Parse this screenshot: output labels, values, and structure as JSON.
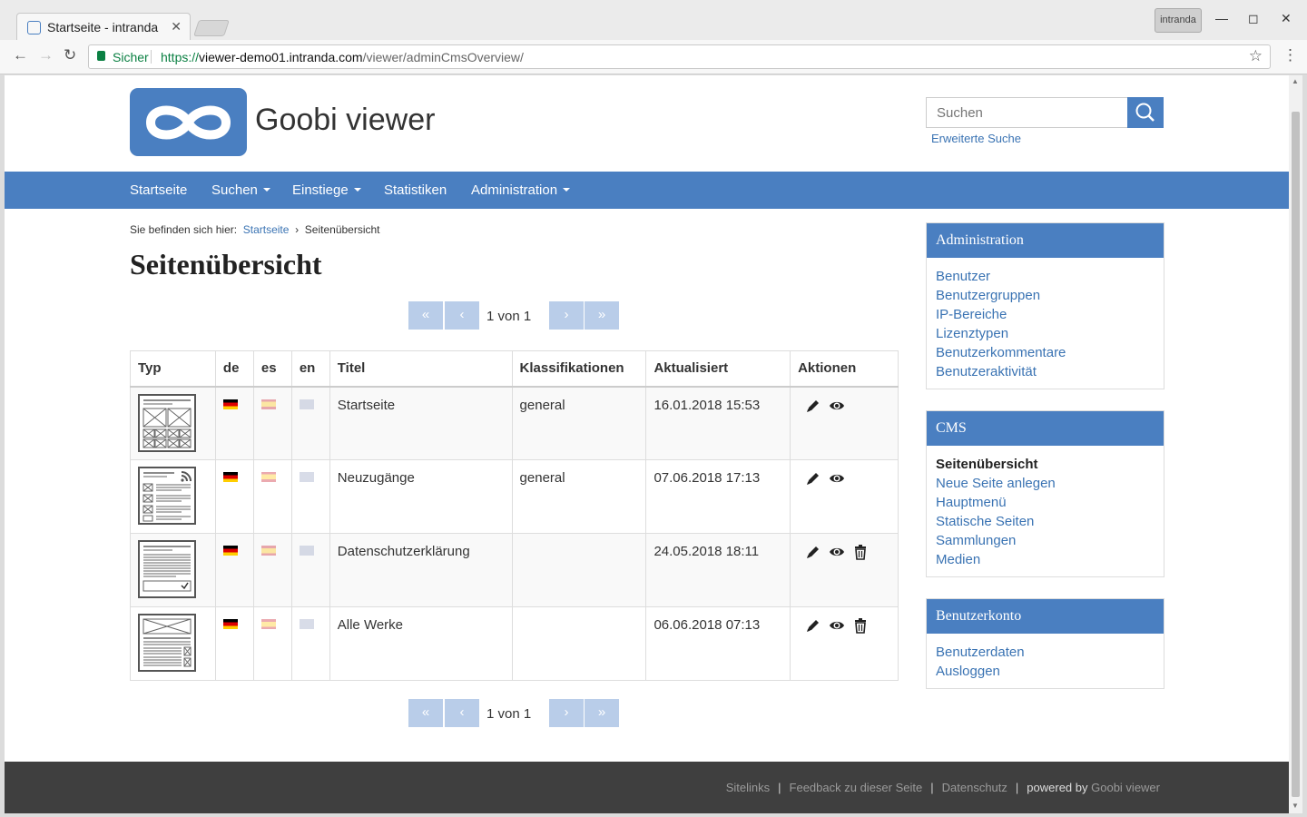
{
  "browser": {
    "tab_title": "Startseite - intranda",
    "profile_label": "intranda",
    "secure_label": "Sicher",
    "url_prefix": "https://",
    "url_host": "viewer-demo01.intranda.com",
    "url_path": "/viewer/adminCmsOverview/"
  },
  "header": {
    "logo_text": "Goobi viewer",
    "search_placeholder": "Suchen",
    "advanced_search": "Erweiterte Suche"
  },
  "nav": {
    "items": [
      {
        "label": "Startseite",
        "dropdown": false
      },
      {
        "label": "Suchen",
        "dropdown": true
      },
      {
        "label": "Einstiege",
        "dropdown": true
      },
      {
        "label": "Statistiken",
        "dropdown": false
      },
      {
        "label": "Administration",
        "dropdown": true
      }
    ]
  },
  "breadcrumb": {
    "prefix": "Sie befinden sich hier:",
    "home": "Startseite",
    "separator": "›",
    "current": "Seitenübersicht"
  },
  "page": {
    "title": "Seitenübersicht"
  },
  "pagination": {
    "first": "«",
    "prev": "‹",
    "next": "›",
    "last": "»",
    "status": "1 von 1"
  },
  "table": {
    "headers": {
      "type": "Typ",
      "de": "de",
      "es": "es",
      "en": "en",
      "title": "Titel",
      "classifications": "Klassifikationen",
      "updated": "Aktualisiert",
      "actions": "Aktionen"
    },
    "rows": [
      {
        "title": "Startseite",
        "classification": "general",
        "updated": "16.01.2018 15:53",
        "template_icon": "grid-template-icon",
        "actions": [
          "edit",
          "view"
        ]
      },
      {
        "title": "Neuzugänge",
        "classification": "general",
        "updated": "07.06.2018 17:13",
        "template_icon": "rss-list-template-icon",
        "actions": [
          "edit",
          "view"
        ]
      },
      {
        "title": "Datenschutzerklärung",
        "classification": "",
        "updated": "24.05.2018 18:11",
        "template_icon": "text-check-template-icon",
        "actions": [
          "edit",
          "view",
          "delete"
        ]
      },
      {
        "title": "Alle Werke",
        "classification": "",
        "updated": "06.06.2018 07:13",
        "template_icon": "image-list-template-icon",
        "actions": [
          "edit",
          "view",
          "delete"
        ]
      }
    ]
  },
  "sidebar": {
    "administration": {
      "title": "Administration",
      "links": [
        "Benutzer",
        "Benutzergruppen",
        "IP-Bereiche",
        "Lizenztypen",
        "Benutzerkommentare",
        "Benutzeraktivität"
      ]
    },
    "cms": {
      "title": "CMS",
      "active": "Seitenübersicht",
      "links": [
        "Neue Seite anlegen",
        "Hauptmenü",
        "Statische Seiten",
        "Sammlungen",
        "Medien"
      ]
    },
    "account": {
      "title": "Benutzerkonto",
      "links": [
        "Benutzerdaten",
        "Ausloggen"
      ]
    }
  },
  "footer": {
    "sitelinks": "Sitelinks",
    "feedback": "Feedback zu dieser Seite",
    "privacy": "Datenschutz",
    "powered_prefix": "powered by",
    "powered_brand": "Goobi viewer",
    "separator": "|"
  },
  "colors": {
    "brand_blue": "#4a7fc1",
    "link_blue": "#3a73b3",
    "footer_bg": "#3f3f3f",
    "pager_disabled": "#b9cde9"
  }
}
